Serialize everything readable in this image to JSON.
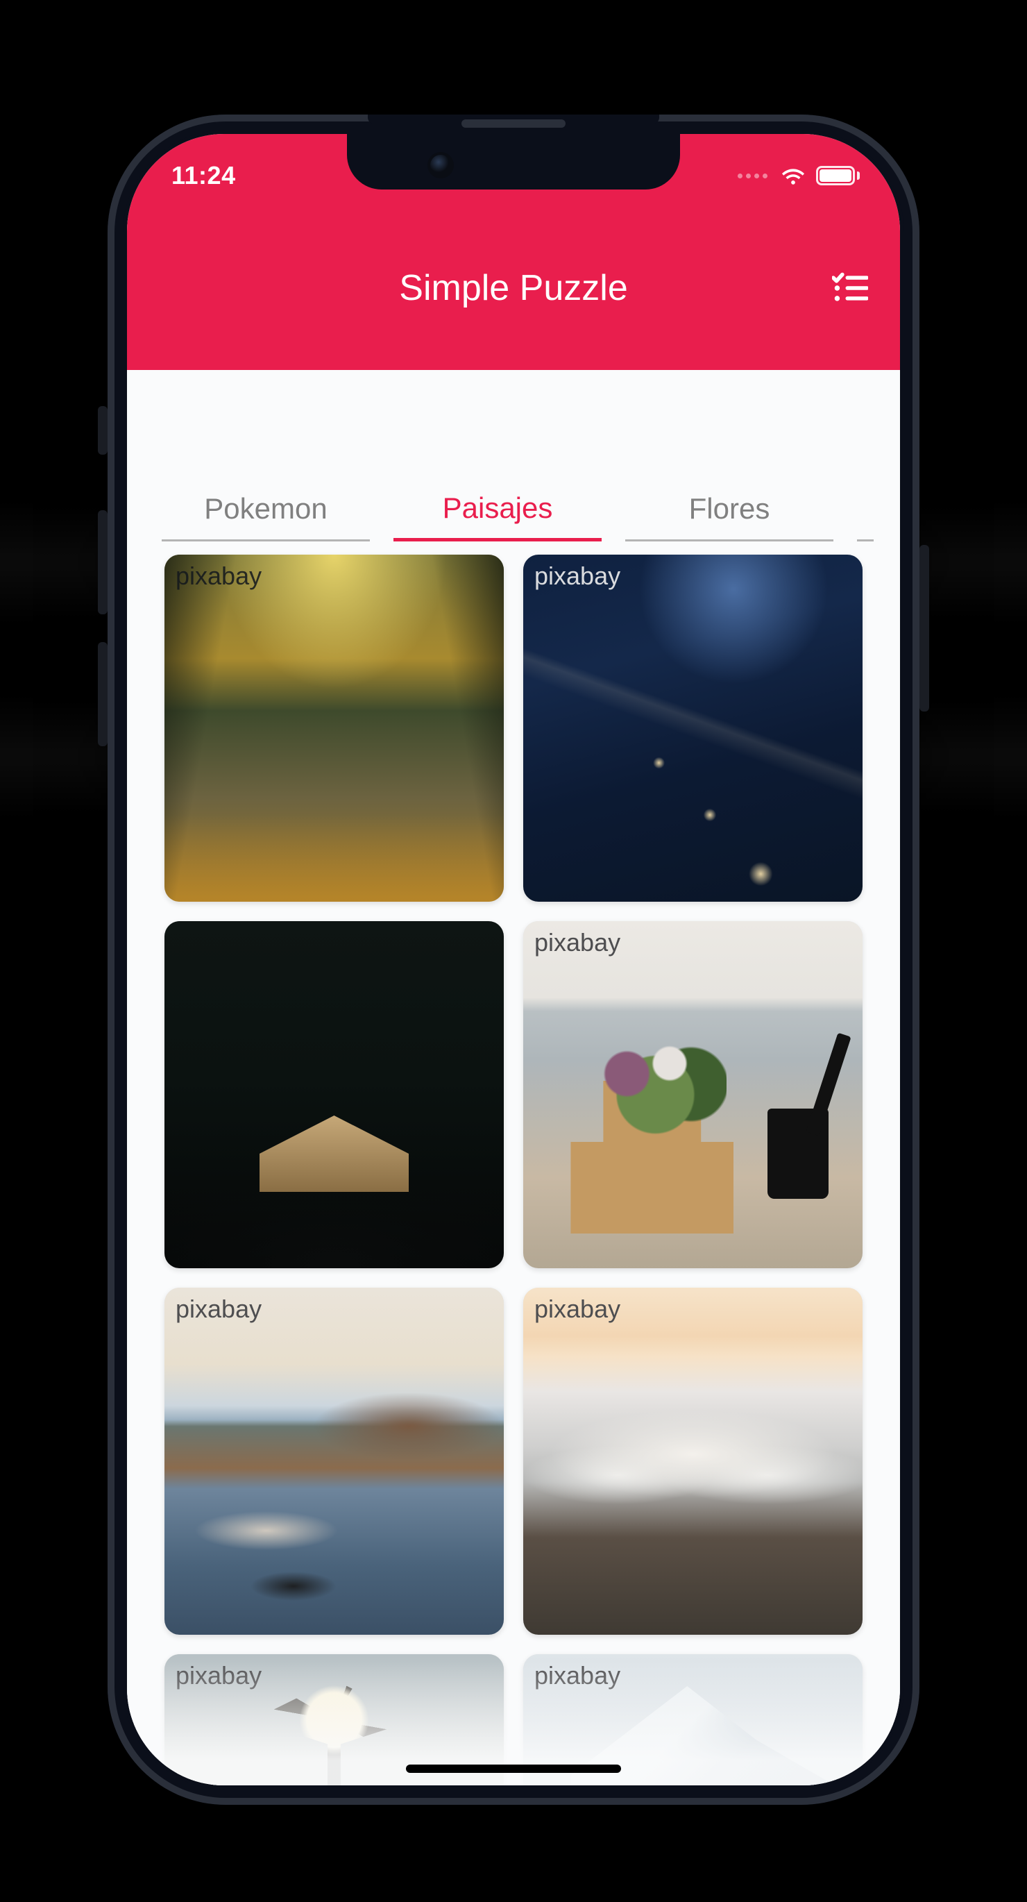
{
  "status": {
    "time": "11:24"
  },
  "header": {
    "title": "Simple Puzzle",
    "action_icon": "checklist-icon"
  },
  "tabs": [
    {
      "label": "Pokemon",
      "active": false
    },
    {
      "label": "Paisajes",
      "active": true
    },
    {
      "label": "Flores",
      "active": false
    }
  ],
  "colors": {
    "accent": "#e91e4d"
  },
  "grid": {
    "source_label": "pixabay",
    "items": [
      {
        "source": "pixabay",
        "alt": "tree-lined autumn road"
      },
      {
        "source": "pixabay",
        "alt": "city at night aerial"
      },
      {
        "source": "",
        "alt": "cabin by dark forest lake"
      },
      {
        "source": "pixabay",
        "alt": "flower box with coffee cup"
      },
      {
        "source": "pixabay",
        "alt": "mountain reflected in lake"
      },
      {
        "source": "pixabay",
        "alt": "sunset above sea of clouds"
      },
      {
        "source": "pixabay",
        "alt": "windmill in hazy light"
      },
      {
        "source": "pixabay",
        "alt": "snowy mountain peak"
      }
    ]
  }
}
